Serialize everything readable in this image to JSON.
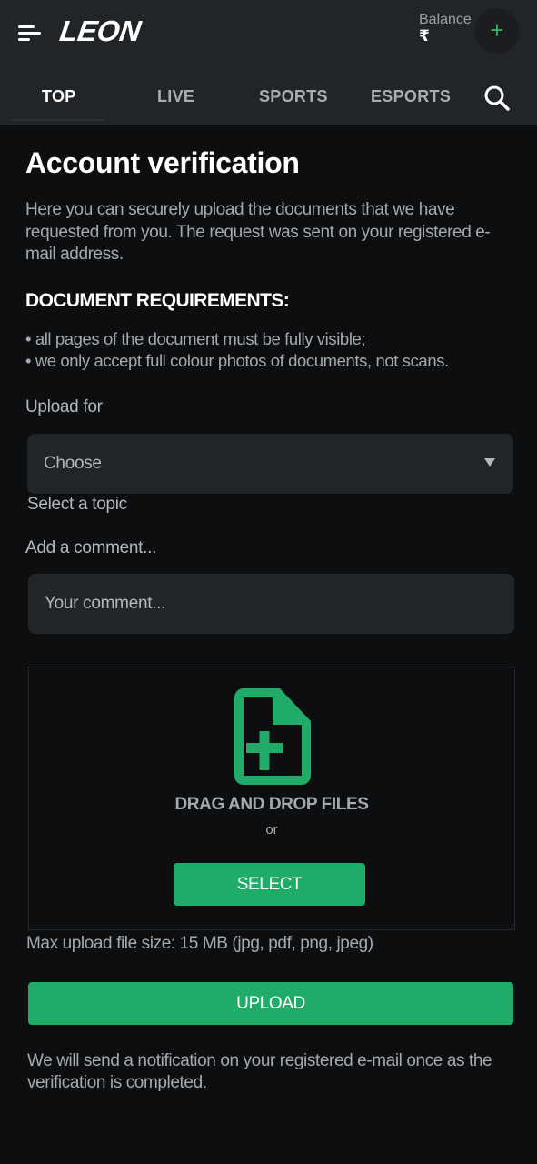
{
  "header": {
    "logo": "LEON",
    "balance_label": "Balance",
    "currency_symbol": "₹",
    "deposit_icon": "plus-icon",
    "menu_icon": "hamburger-menu-icon",
    "search_icon": "search-icon"
  },
  "tabs": [
    {
      "label": "TOP",
      "active": true
    },
    {
      "label": "LIVE",
      "active": false
    },
    {
      "label": "SPORTS",
      "active": false
    },
    {
      "label": "ESPORTS",
      "active": false
    }
  ],
  "page": {
    "title": "Account verification",
    "intro": "Here you can securely upload the documents that we have requested from you. The request was sent on your registered e-mail address.",
    "requirements_title": "DOCUMENT REQUIREMENTS:",
    "requirements": [
      "• all pages of the document must be fully visible;",
      "• we only accept full colour photos of documents, not scans."
    ]
  },
  "form": {
    "upload_for_label": "Upload for",
    "select_value": "Choose",
    "select_hint": "Select a topic",
    "comment_label": "Add a comment...",
    "comment_placeholder": "Your comment...",
    "comment_value": ""
  },
  "dropzone": {
    "icon": "file-add-icon",
    "drag_text": "DRAG AND DROP FILES",
    "or_text": "or",
    "select_label": "SELECT"
  },
  "max_size_text": "Max upload file size: 15 MB (jpg, pdf, png, jpeg)",
  "upload_label": "UPLOAD",
  "notice": "We will send a notification on your registered e-mail once as the verification is completed.",
  "colors": {
    "accent_green": "#21ab68",
    "header_bg": "#222528",
    "page_bg": "#0d0e10"
  }
}
